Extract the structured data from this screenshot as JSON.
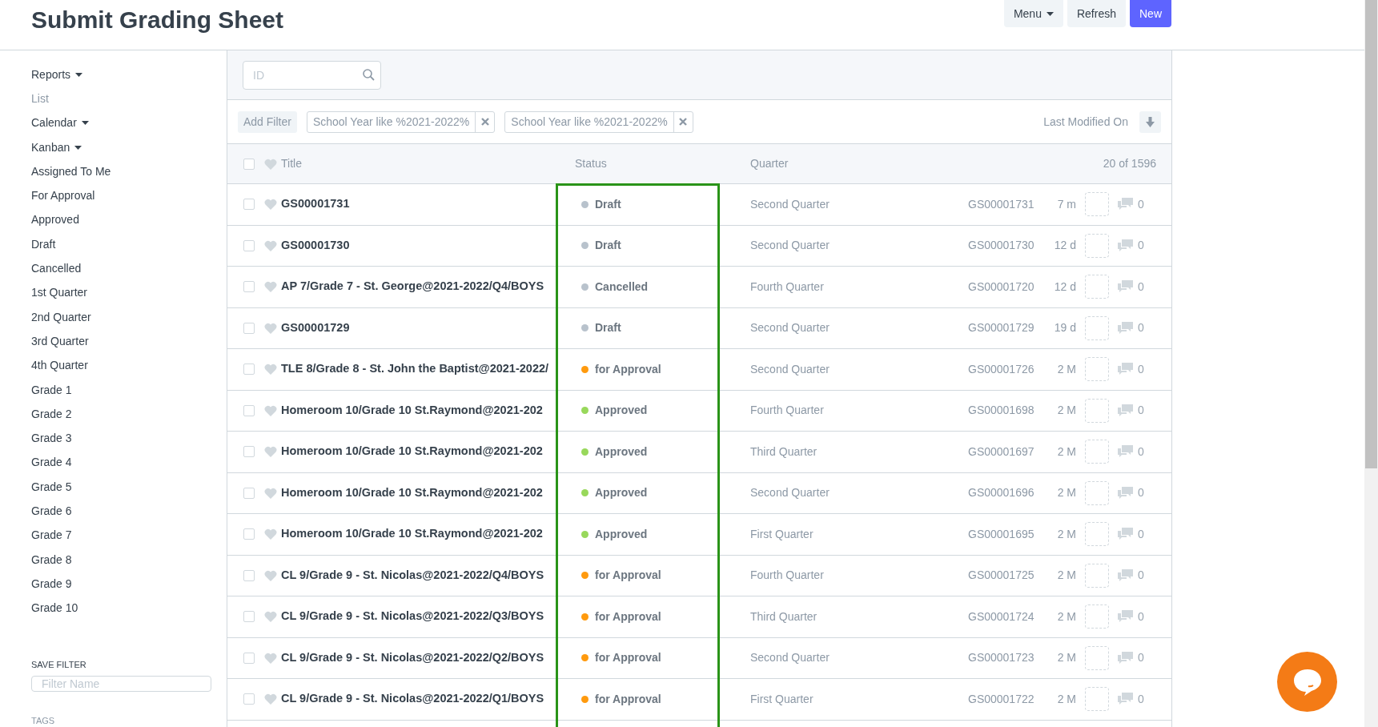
{
  "page_title": "Submit Grading Sheet",
  "header_buttons": [
    {
      "label": "Menu",
      "kind": "dropdown"
    },
    {
      "label": "Refresh",
      "kind": "plain"
    },
    {
      "label": "New",
      "kind": "primary"
    }
  ],
  "sidebar": {
    "items": [
      {
        "label": "Reports",
        "kind": "dropdown",
        "selected": false
      },
      {
        "label": "List",
        "kind": "link",
        "selected": true
      },
      {
        "label": "Calendar",
        "kind": "dropdown",
        "selected": false
      },
      {
        "label": "Kanban",
        "kind": "dropdown",
        "selected": false
      },
      {
        "label": "Assigned To Me",
        "kind": "link",
        "selected": false
      },
      {
        "label": "For Approval",
        "kind": "link",
        "selected": false
      },
      {
        "label": "Approved",
        "kind": "link",
        "selected": false
      },
      {
        "label": "Draft",
        "kind": "link",
        "selected": false
      },
      {
        "label": "Cancelled",
        "kind": "link",
        "selected": false
      },
      {
        "label": "1st Quarter",
        "kind": "link",
        "selected": false
      },
      {
        "label": "2nd Quarter",
        "kind": "link",
        "selected": false
      },
      {
        "label": "3rd Quarter",
        "kind": "link",
        "selected": false
      },
      {
        "label": "4th Quarter",
        "kind": "link",
        "selected": false
      },
      {
        "label": "Grade 1",
        "kind": "link",
        "selected": false
      },
      {
        "label": "Grade 2",
        "kind": "link",
        "selected": false
      },
      {
        "label": "Grade 3",
        "kind": "link",
        "selected": false
      },
      {
        "label": "Grade 4",
        "kind": "link",
        "selected": false
      },
      {
        "label": "Grade 5",
        "kind": "link",
        "selected": false
      },
      {
        "label": "Grade 6",
        "kind": "link",
        "selected": false
      },
      {
        "label": "Grade 7",
        "kind": "link",
        "selected": false
      },
      {
        "label": "Grade 8",
        "kind": "link",
        "selected": false
      },
      {
        "label": "Grade 9",
        "kind": "link",
        "selected": false
      },
      {
        "label": "Grade 10",
        "kind": "link",
        "selected": false
      }
    ],
    "save_filter": {
      "heading": "SAVE FILTER",
      "placeholder": "Filter Name"
    },
    "tags_heading": "TAGS"
  },
  "search": {
    "placeholder": "ID"
  },
  "filters": {
    "add_label": "Add Filter",
    "active": [
      "School Year like %2021-2022%",
      "School Year like %2021-2022%"
    ],
    "sort_label": "Last Modified On"
  },
  "table": {
    "columns": [
      "Title",
      "Status",
      "Quarter"
    ],
    "count": "20 of 1596",
    "select_all_checked": false,
    "rows": [
      {
        "title": "GS00001731",
        "status": "Draft",
        "color": "#b8c2cc",
        "quarter": "Second Quarter",
        "id": "GS00001731",
        "age": "7 m",
        "comments": "0",
        "checked": false
      },
      {
        "title": "GS00001730",
        "status": "Draft",
        "color": "#b8c2cc",
        "quarter": "Second Quarter",
        "id": "GS00001730",
        "age": "12 d",
        "comments": "0",
        "checked": false
      },
      {
        "title": "AP 7/Grade 7 - St. George@2021-2022/Q4/BOYS",
        "status": "Cancelled",
        "color": "#b8c2cc",
        "quarter": "Fourth Quarter",
        "id": "GS00001720",
        "age": "12 d",
        "comments": "0",
        "checked": false
      },
      {
        "title": "GS00001729",
        "status": "Draft",
        "color": "#b8c2cc",
        "quarter": "Second Quarter",
        "id": "GS00001729",
        "age": "19 d",
        "comments": "0",
        "checked": false
      },
      {
        "title": "TLE 8/Grade 8 - St. John the Baptist@2021-2022/",
        "status": "for Approval",
        "color": "#ff9a0e",
        "quarter": "Second Quarter",
        "id": "GS00001726",
        "age": "2 M",
        "comments": "0",
        "checked": false
      },
      {
        "title": "Homeroom 10/Grade 10 St.Raymond@2021-202",
        "status": "Approved",
        "color": "#98d85b",
        "quarter": "Fourth Quarter",
        "id": "GS00001698",
        "age": "2 M",
        "comments": "0",
        "checked": false
      },
      {
        "title": "Homeroom 10/Grade 10 St.Raymond@2021-202",
        "status": "Approved",
        "color": "#98d85b",
        "quarter": "Third Quarter",
        "id": "GS00001697",
        "age": "2 M",
        "comments": "0",
        "checked": false
      },
      {
        "title": "Homeroom 10/Grade 10 St.Raymond@2021-202",
        "status": "Approved",
        "color": "#98d85b",
        "quarter": "Second Quarter",
        "id": "GS00001696",
        "age": "2 M",
        "comments": "0",
        "checked": false
      },
      {
        "title": "Homeroom 10/Grade 10 St.Raymond@2021-202",
        "status": "Approved",
        "color": "#98d85b",
        "quarter": "First Quarter",
        "id": "GS00001695",
        "age": "2 M",
        "comments": "0",
        "checked": false
      },
      {
        "title": "CL 9/Grade 9 - St. Nicolas@2021-2022/Q4/BOYS",
        "status": "for Approval",
        "color": "#ff9a0e",
        "quarter": "Fourth Quarter",
        "id": "GS00001725",
        "age": "2 M",
        "comments": "0",
        "checked": false
      },
      {
        "title": "CL 9/Grade 9 - St. Nicolas@2021-2022/Q3/BOYS",
        "status": "for Approval",
        "color": "#ff9a0e",
        "quarter": "Third Quarter",
        "id": "GS00001724",
        "age": "2 M",
        "comments": "0",
        "checked": false
      },
      {
        "title": "CL 9/Grade 9 - St. Nicolas@2021-2022/Q2/BOYS",
        "status": "for Approval",
        "color": "#ff9a0e",
        "quarter": "Second Quarter",
        "id": "GS00001723",
        "age": "2 M",
        "comments": "0",
        "checked": false
      },
      {
        "title": "CL 9/Grade 9 - St. Nicolas@2021-2022/Q1/BOYS",
        "status": "for Approval",
        "color": "#ff9a0e",
        "quarter": "First Quarter",
        "id": "GS00001722",
        "age": "2 M",
        "comments": "0",
        "checked": false
      }
    ]
  }
}
